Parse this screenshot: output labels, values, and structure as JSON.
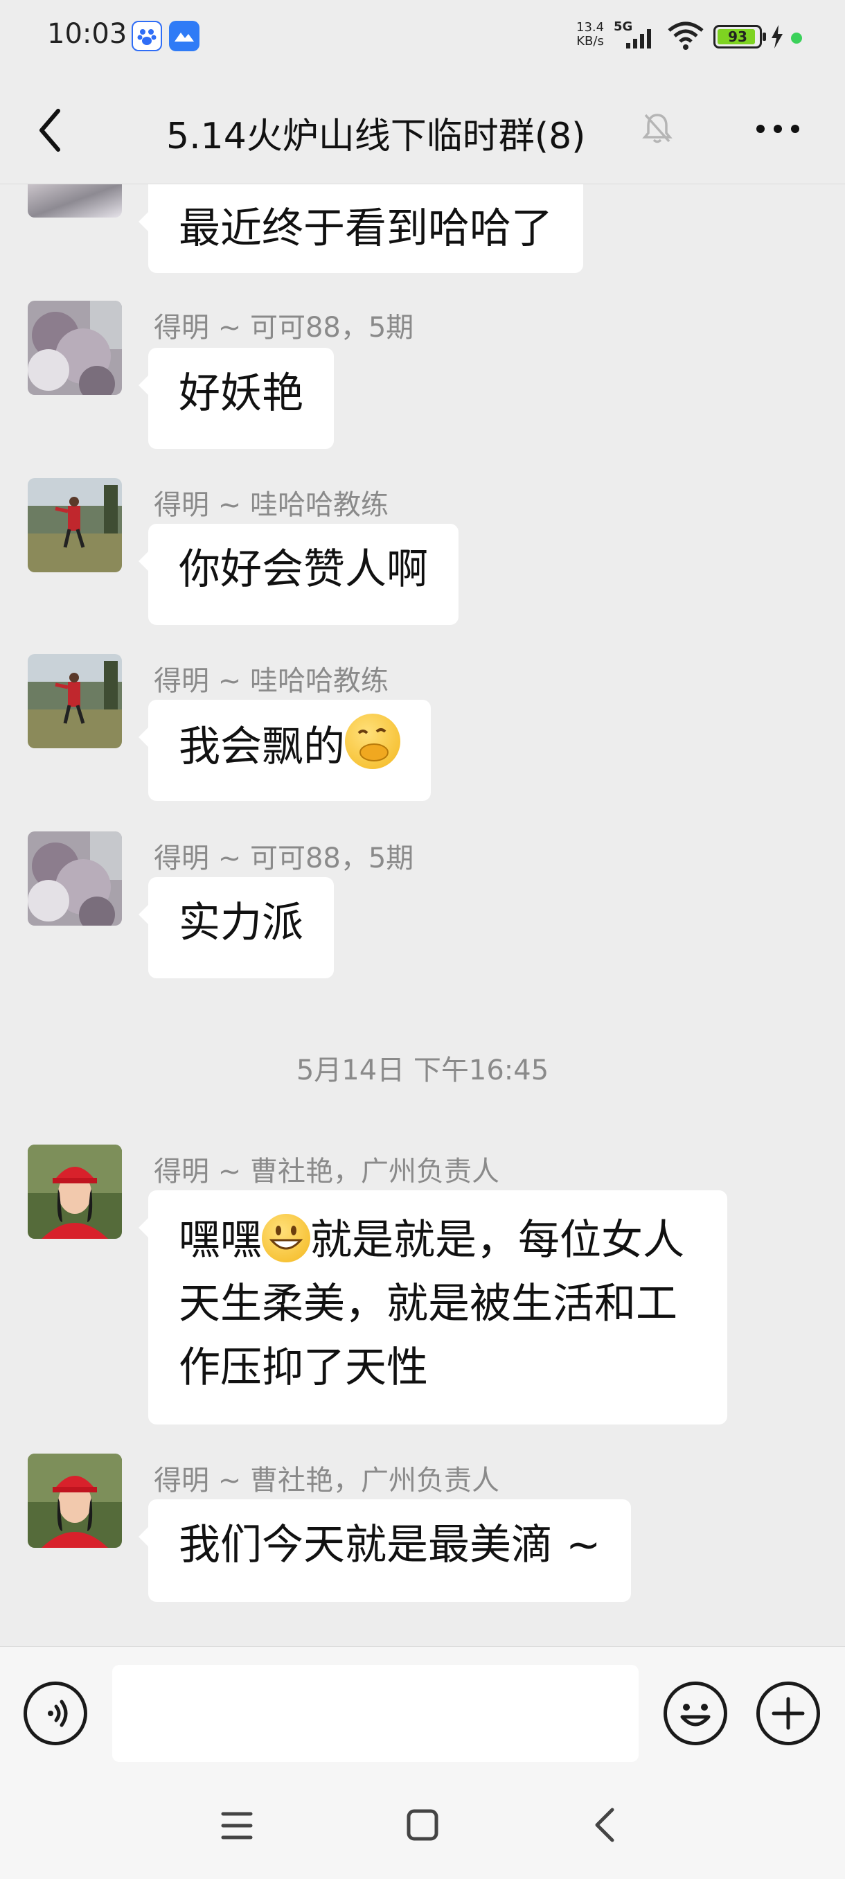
{
  "status_bar": {
    "time": "10:03",
    "network_speed_value": "13.4",
    "network_speed_unit": "KB/s",
    "network_type": "5G",
    "battery_level": "93",
    "battery_fraction": 0.93,
    "battery_color": "#7ed321",
    "dot_color": "#3bd15a"
  },
  "header": {
    "title": "5.14火炉山线下临时群(8)"
  },
  "messages": [
    {
      "sender": "",
      "text": "最近终于看到哈哈了",
      "avatar": "flowers-photo"
    },
    {
      "sender": "得明 ~ 可可88，5期",
      "text": "好妖艳",
      "avatar": "flowers-photo"
    },
    {
      "sender": "得明 ~ 哇哈哈教练",
      "text": "你好会赞人啊",
      "avatar": "man-outdoors-photo"
    },
    {
      "sender": "得明 ~ 哇哈哈教练",
      "text": "我会飘的",
      "emoji": "hand-over-mouth-emoji",
      "avatar": "man-outdoors-photo"
    },
    {
      "sender": "得明 ~ 可可88，5期",
      "text": "实力派",
      "avatar": "flowers-photo"
    },
    {
      "sender": "得明 ~ 曹社艳，广州负责人",
      "text_a": "嘿嘿",
      "emoji": "grinning-emoji",
      "text_b": "就是就是，每位女人",
      "line2": "天生柔美，就是被生活和工",
      "line3": "作压抑了天性",
      "avatar": "woman-red-cap-photo"
    },
    {
      "sender": "得明 ~ 曹社艳，广州负责人",
      "text": "我们今天就是最美滴 ~",
      "avatar": "woman-red-cap-photo"
    }
  ],
  "timestamp": "5月14日 下午16:45",
  "input_bar": {
    "voice_icon": "voice-icon",
    "emoji_icon": "smiley-icon",
    "plus_icon": "plus-icon",
    "placeholder": ""
  },
  "nav_bar": {
    "icons": [
      "menu-icon",
      "home-icon",
      "back-icon"
    ]
  }
}
